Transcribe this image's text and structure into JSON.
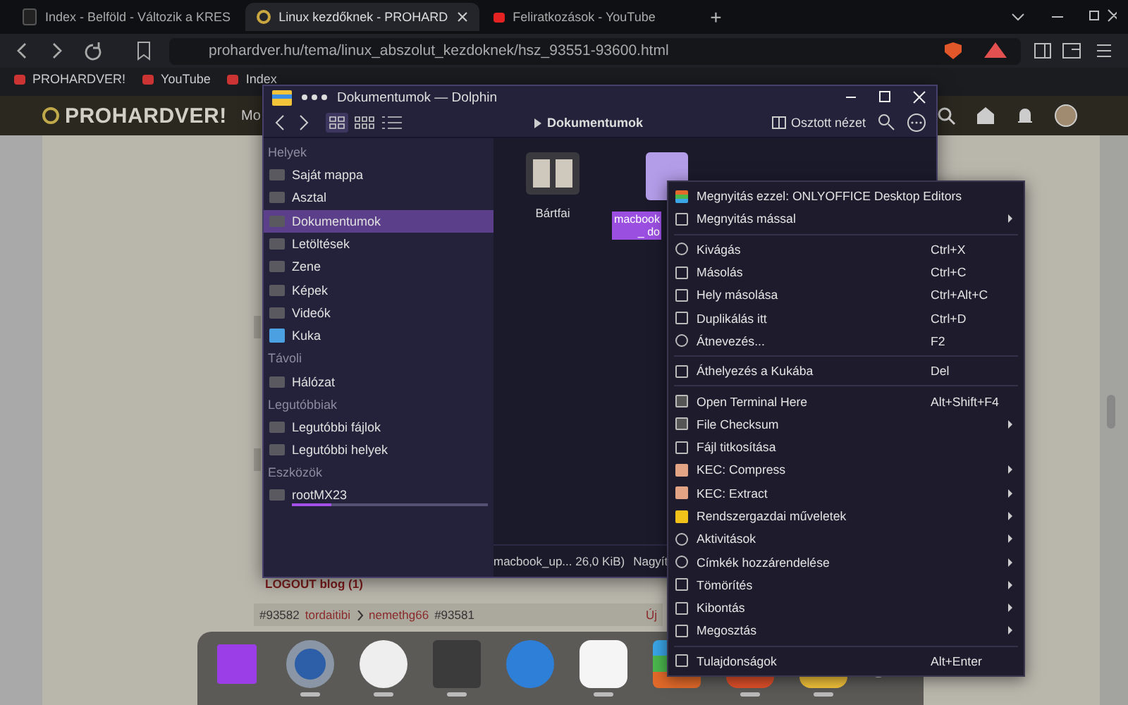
{
  "browser": {
    "tabs": [
      {
        "title": "Index - Belföld - Változik a KRES",
        "selected": false
      },
      {
        "title": "Linux kezdőknek - PROHARD",
        "selected": true
      },
      {
        "title": "Feliratkozások - YouTube",
        "selected": false
      }
    ],
    "new_tab": "+",
    "url": "prohardver.hu/tema/linux_abszolut_kezdoknek/hsz_93551-93600.html",
    "bookmarks": [
      "PROHARDVER!",
      "YouTube",
      "Index"
    ],
    "site_logo": "PROHARDVER!",
    "site_nav": "Mo",
    "page": {
      "blog_link": "LOGOUT blog (1)",
      "post_number": "#93582",
      "author": "tordaitibi",
      "reply_to": "nemethg66",
      "reply_number": "#93581",
      "new_label": "Új"
    }
  },
  "dolphin": {
    "title": "Dokumentumok — Dolphin",
    "breadcrumb": "Dokumentumok",
    "split_view": "Osztott nézet",
    "sections": [
      {
        "title": "Helyek",
        "items": [
          {
            "label": "Saját mappa",
            "selected": false
          },
          {
            "label": "Asztal",
            "selected": false
          },
          {
            "label": "Dokumentumok",
            "selected": true
          },
          {
            "label": "Letöltések",
            "selected": false
          },
          {
            "label": "Zene",
            "selected": false
          },
          {
            "label": "Képek",
            "selected": false
          },
          {
            "label": "Videók",
            "selected": false
          },
          {
            "label": "Kuka",
            "selected": false
          }
        ]
      },
      {
        "title": "Távoli",
        "items": [
          {
            "label": "Hálózat",
            "selected": false
          }
        ]
      },
      {
        "title": "Legutóbbiak",
        "items": [
          {
            "label": "Legutóbbi fájlok",
            "selected": false
          },
          {
            "label": "Legutóbbi helyek",
            "selected": false
          }
        ]
      },
      {
        "title": "Eszközök",
        "items": [
          {
            "label": "rootMX23",
            "selected": false,
            "level": 0.2
          }
        ]
      }
    ],
    "files": [
      {
        "name": "Bártfai",
        "kind": "folder",
        "selected": false
      },
      {
        "name": "macbook_ do",
        "kind": "document",
        "selected": true
      }
    ],
    "status": "macbook_up... 26,0 KiB)",
    "zoom_label": "Nagyít"
  },
  "context_menu": [
    {
      "kind": "item",
      "label": "Megnyitás ezzel: ONLYOFFICE Desktop Editors",
      "submenu": false
    },
    {
      "kind": "item",
      "label": "Megnyitás mással",
      "submenu": true
    },
    {
      "kind": "separator"
    },
    {
      "kind": "item",
      "label": "Kivágás",
      "shortcut": "Ctrl+X",
      "submenu": false
    },
    {
      "kind": "item",
      "label": "Másolás",
      "shortcut": "Ctrl+C",
      "submenu": false
    },
    {
      "kind": "item",
      "label": "Hely másolása",
      "shortcut": "Ctrl+Alt+C",
      "submenu": false
    },
    {
      "kind": "item",
      "label": "Duplikálás itt",
      "shortcut": "Ctrl+D",
      "submenu": false
    },
    {
      "kind": "item",
      "label": "Átnevezés...",
      "shortcut": "F2",
      "submenu": false
    },
    {
      "kind": "separator"
    },
    {
      "kind": "item",
      "label": "Áthelyezés a Kukába",
      "shortcut": "Del",
      "submenu": false
    },
    {
      "kind": "separator"
    },
    {
      "kind": "item",
      "label": "Open Terminal Here",
      "shortcut": "Alt+Shift+F4",
      "submenu": false
    },
    {
      "kind": "item",
      "label": "File Checksum",
      "submenu": true
    },
    {
      "kind": "item",
      "label": "Fájl titkosítása",
      "submenu": false
    },
    {
      "kind": "item",
      "label": "KEC: Compress",
      "submenu": true
    },
    {
      "kind": "item",
      "label": "KEC: Extract",
      "submenu": true
    },
    {
      "kind": "item",
      "label": "Rendszergazdai műveletek",
      "submenu": true
    },
    {
      "kind": "item",
      "label": "Aktivitások",
      "submenu": true
    },
    {
      "kind": "item",
      "label": "Címkék hozzárendelése",
      "submenu": true
    },
    {
      "kind": "item",
      "label": "Tömörítés",
      "submenu": true
    },
    {
      "kind": "item",
      "label": "Kibontás",
      "submenu": true
    },
    {
      "kind": "item",
      "label": "Megosztás",
      "submenu": true
    },
    {
      "kind": "separator"
    },
    {
      "kind": "item",
      "label": "Tulajdonságok",
      "shortcut": "Alt+Enter",
      "submenu": false
    }
  ],
  "dock": {
    "apps": [
      {
        "running": false
      },
      {
        "running": true
      },
      {
        "running": true
      },
      {
        "running": true
      },
      {
        "running": false
      },
      {
        "running": true
      },
      {
        "running": false
      },
      {
        "running": true
      },
      {
        "running": true
      }
    ]
  }
}
